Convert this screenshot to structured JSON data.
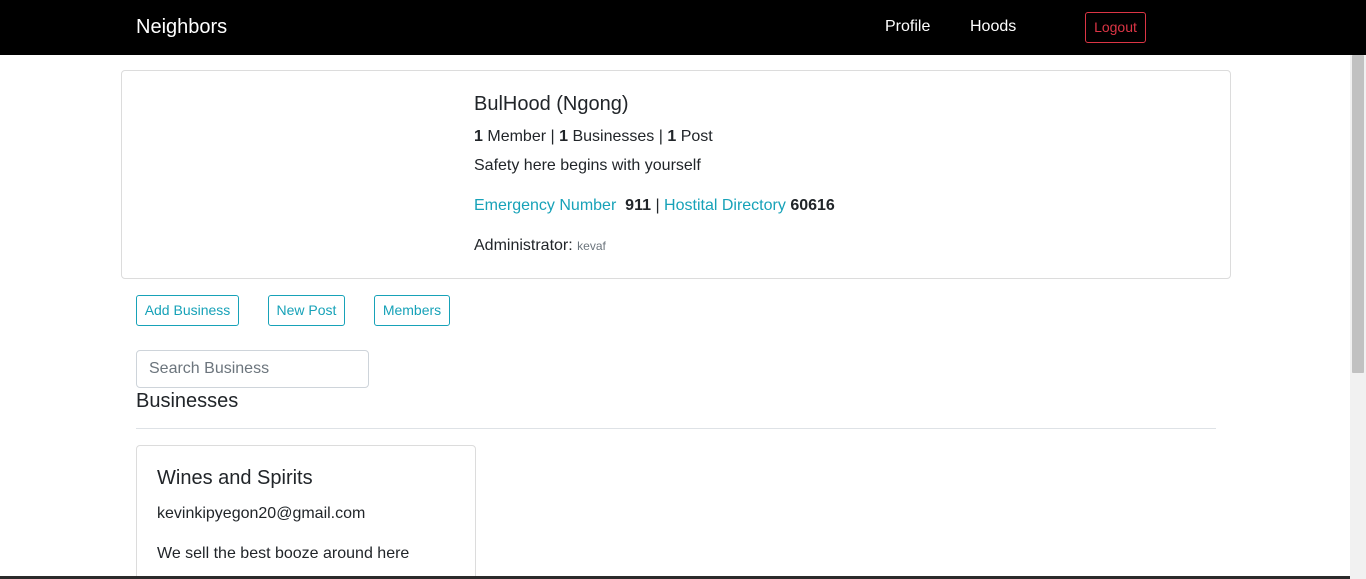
{
  "navbar": {
    "brand": "Neighbors",
    "links": {
      "profile": "Profile",
      "hoods": "Hoods"
    },
    "logout_label": "Logout"
  },
  "hood": {
    "name": "BulHood (Ngong)",
    "stats": {
      "members_count": "1",
      "members_label": "Member",
      "businesses_count": "1",
      "businesses_label": "Businesses",
      "posts_count": "1",
      "posts_label": "Post",
      "separator": "|"
    },
    "description": "Safety here begins with yourself",
    "emergency_label": "Emergency Number",
    "emergency_number": "911",
    "hospital_label": "Hostital Directory",
    "hospital_number": "60616",
    "admin_label": "Administrator:",
    "admin_name": "kevaf"
  },
  "actions": {
    "add_business": "Add Business",
    "new_post": "New Post",
    "members": "Members"
  },
  "search": {
    "placeholder": "Search Business",
    "value": ""
  },
  "businesses": {
    "title": "Businesses",
    "items": [
      {
        "name": "Wines and Spirits",
        "email": "kevinkipyegon20@gmail.com",
        "description": "We sell the best booze around here"
      }
    ]
  },
  "colors": {
    "navbar_bg": "#000000",
    "accent_teal": "#17a2b8",
    "danger_red": "#dc3545"
  }
}
